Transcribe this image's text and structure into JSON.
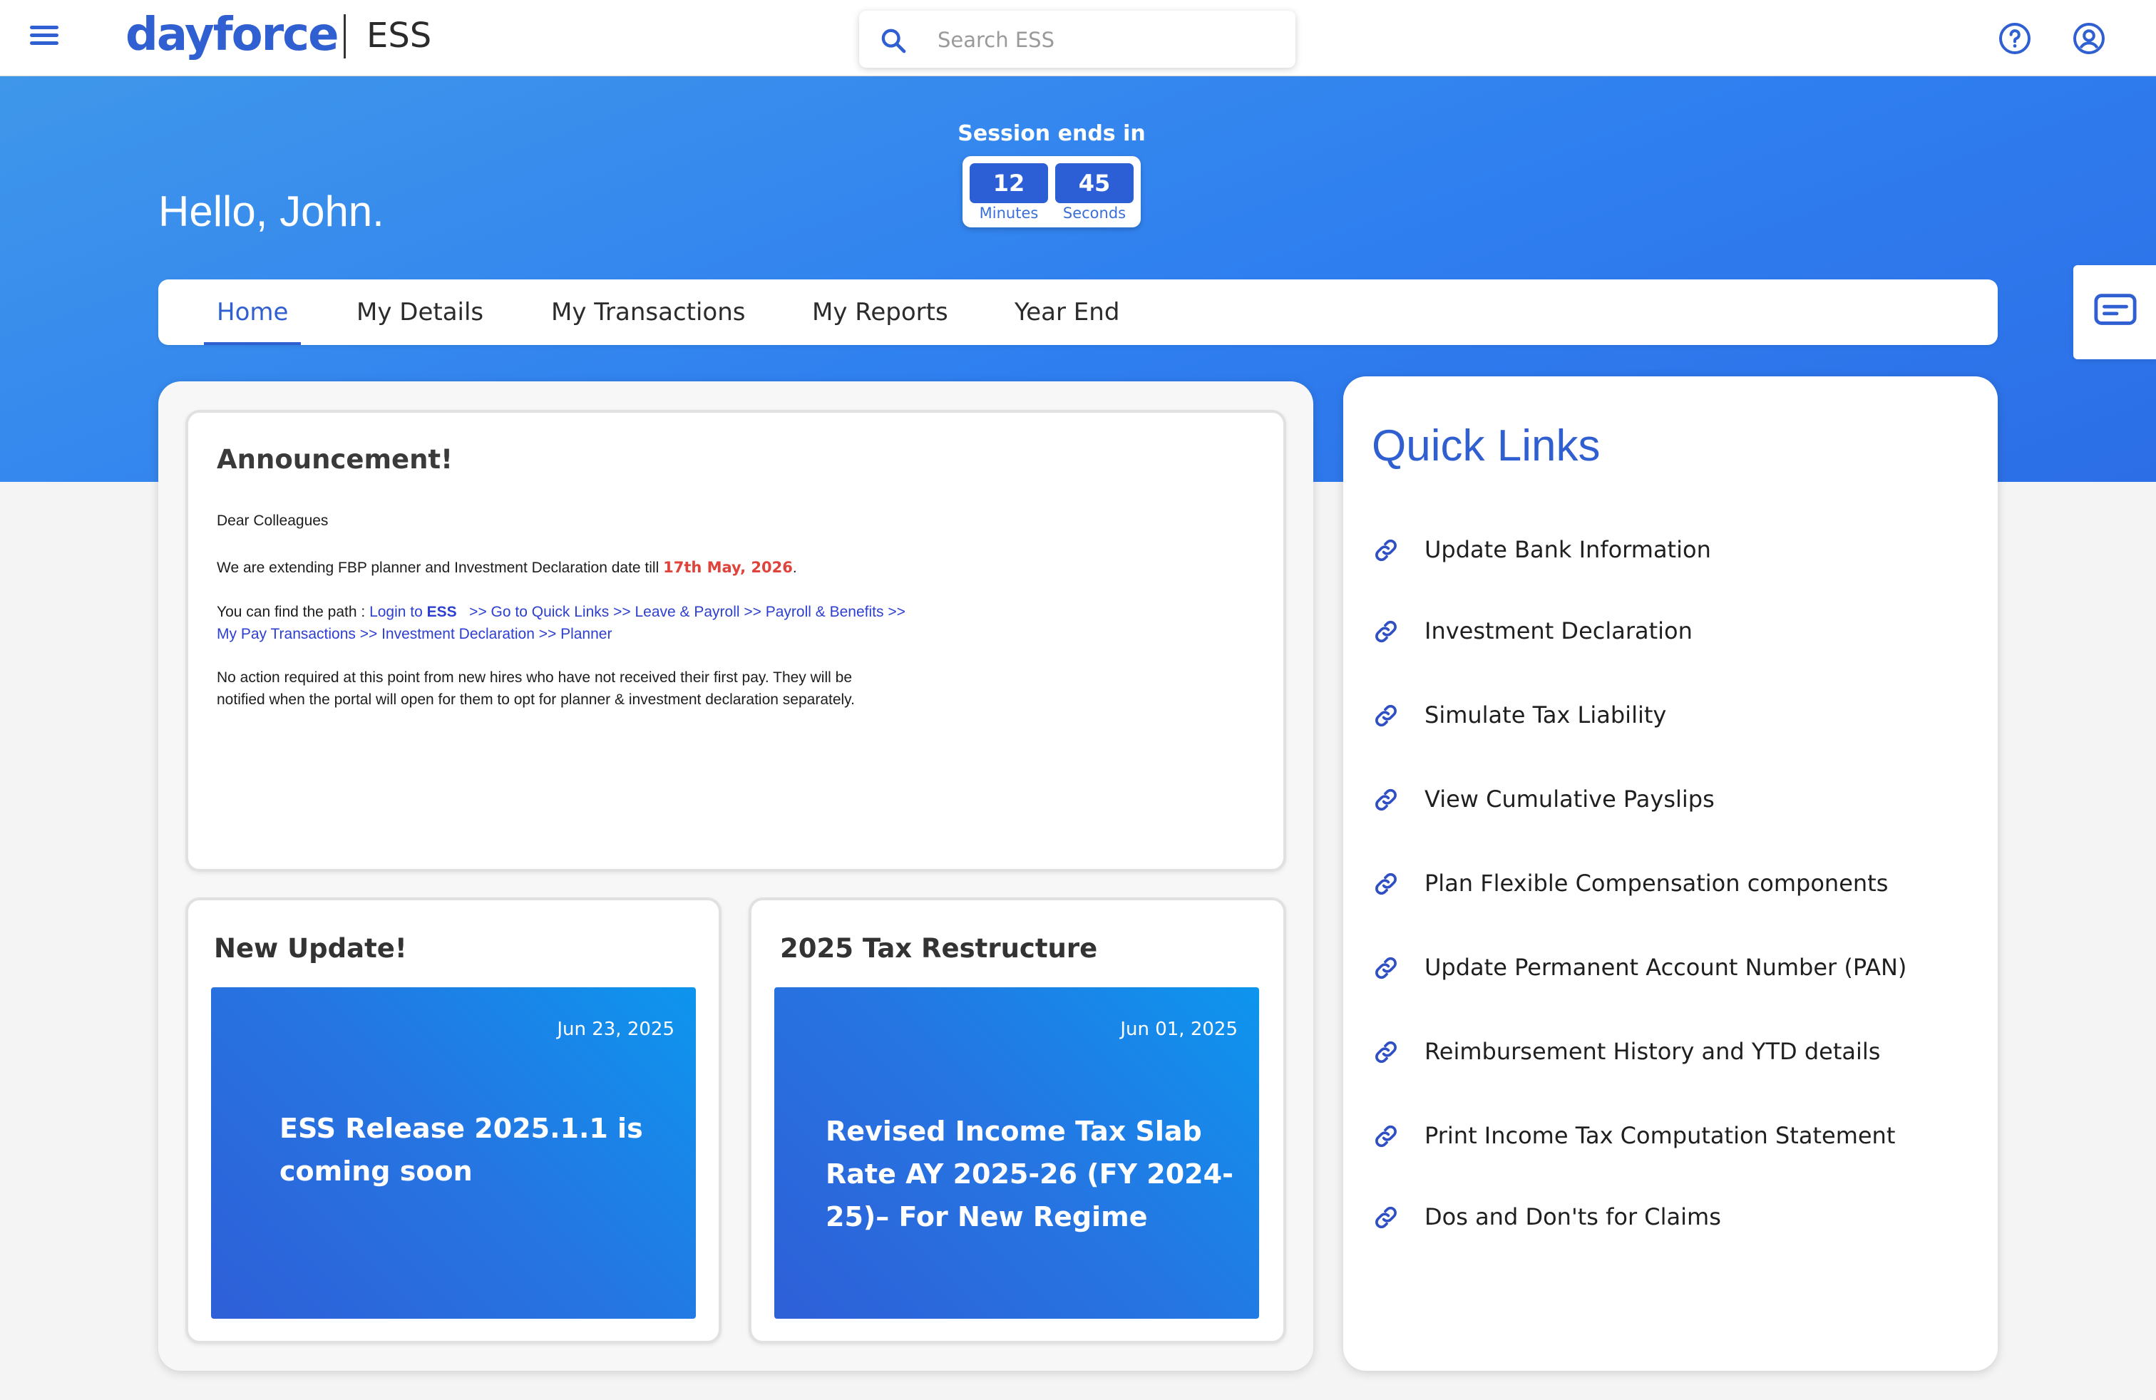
{
  "header": {
    "logo_text": "dayforce",
    "product_name": "ESS",
    "search_placeholder": "Search ESS",
    "icons": [
      "menu-icon",
      "search-icon",
      "help-icon",
      "account-icon"
    ]
  },
  "banner": {
    "greeting": "Hello, John.",
    "session_label": "Session ends in",
    "minutes_value": "12",
    "minutes_label": "Minutes",
    "seconds_value": "45",
    "seconds_label": "Seconds"
  },
  "tabs": [
    {
      "label": "Home",
      "active": true
    },
    {
      "label": "My Details",
      "active": false
    },
    {
      "label": "My Transactions",
      "active": false
    },
    {
      "label": "My Reports",
      "active": false
    },
    {
      "label": "Year End",
      "active": false
    }
  ],
  "announcement": {
    "title": "Announcement!",
    "salutation": "Dear Colleagues",
    "line1_prefix": "We are extending FBP planner and Investment Declaration date till ",
    "line1_date": "17th May, 2026",
    "line1_suffix": ".",
    "path_prefix": "You can find the path : ",
    "path_login": "Login to ",
    "path_ess": "ESS",
    "path_rest1": "   >> Go to Quick Links >> Leave & Payroll >> Payroll & Benefits >>",
    "path_rest2": "My Pay Transactions >> Investment Declaration >> Planner",
    "note_line1": "No action required at this point from new hires who have not received their first pay. They will be",
    "note_line2": "notified when the portal will open for them to opt for planner & investment declaration separately."
  },
  "updates": [
    {
      "card_title": "New Update!",
      "date": "Jun 23, 2025",
      "text": "ESS Release 2025.1.1 is coming soon"
    },
    {
      "card_title": "2025 Tax Restructure",
      "date": "Jun 01, 2025",
      "text": "Revised Income Tax Slab Rate AY 2025-26 (FY 2024-25)– For New Regime"
    }
  ],
  "quick_links": {
    "title": "Quick Links",
    "items": [
      "Update Bank Information",
      "Investment Declaration",
      "Simulate Tax Liability",
      "View Cumulative Payslips",
      "Plan Flexible Compensation components",
      "Update Permanent Account Number (PAN)",
      "Reimbursement History and YTD details",
      "Print Income Tax Computation Statement",
      "Dos and Don'ts for Claims"
    ]
  },
  "colors": {
    "brand_blue": "#2f5fd0",
    "banner_blue": "#3a8bec",
    "highlight_red": "#e0433b",
    "link_blue": "#2c3fd0"
  }
}
